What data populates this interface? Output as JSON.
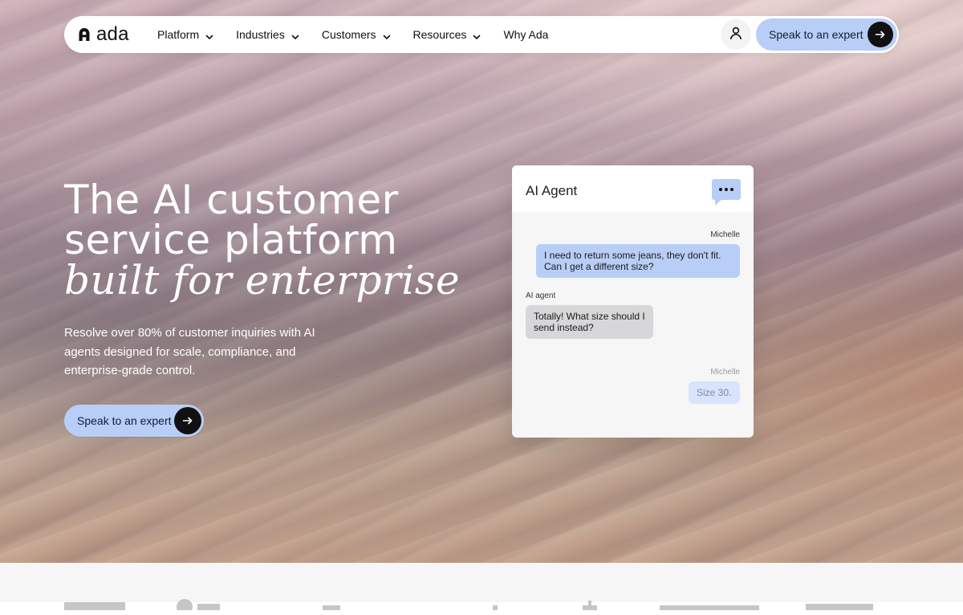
{
  "brand": {
    "name": "ada"
  },
  "nav": {
    "items": [
      {
        "label": "Platform",
        "has_dropdown": true
      },
      {
        "label": "Industries",
        "has_dropdown": true
      },
      {
        "label": "Customers",
        "has_dropdown": true
      },
      {
        "label": "Resources",
        "has_dropdown": true
      },
      {
        "label": "Why Ada",
        "has_dropdown": false
      }
    ],
    "cta_label": "Speak to an expert",
    "icons": {
      "account": "person-icon",
      "cta": "arrow-right-icon"
    }
  },
  "hero": {
    "headline": {
      "line1": "The AI customer",
      "line2": "service platform",
      "line3": "built for enterprise"
    },
    "subcopy": "Resolve over 80% of customer inquiries with AI agents designed for scale, compliance, and enterprise-grade control.",
    "cta_label": "Speak to an expert"
  },
  "chat_demo": {
    "title": "AI Agent",
    "messages": [
      {
        "sender": "Michelle",
        "text": "I need to return some jeans, they don't fit. Can I get a different size?"
      },
      {
        "sender": "AI agent",
        "text": "Totally! What size should I send instead?"
      },
      {
        "sender": "Michelle",
        "text": "Size 30."
      }
    ]
  },
  "colors": {
    "accent_blue": "#b9cef6",
    "text_dark": "#111111",
    "hero_text": "#ffffff"
  }
}
